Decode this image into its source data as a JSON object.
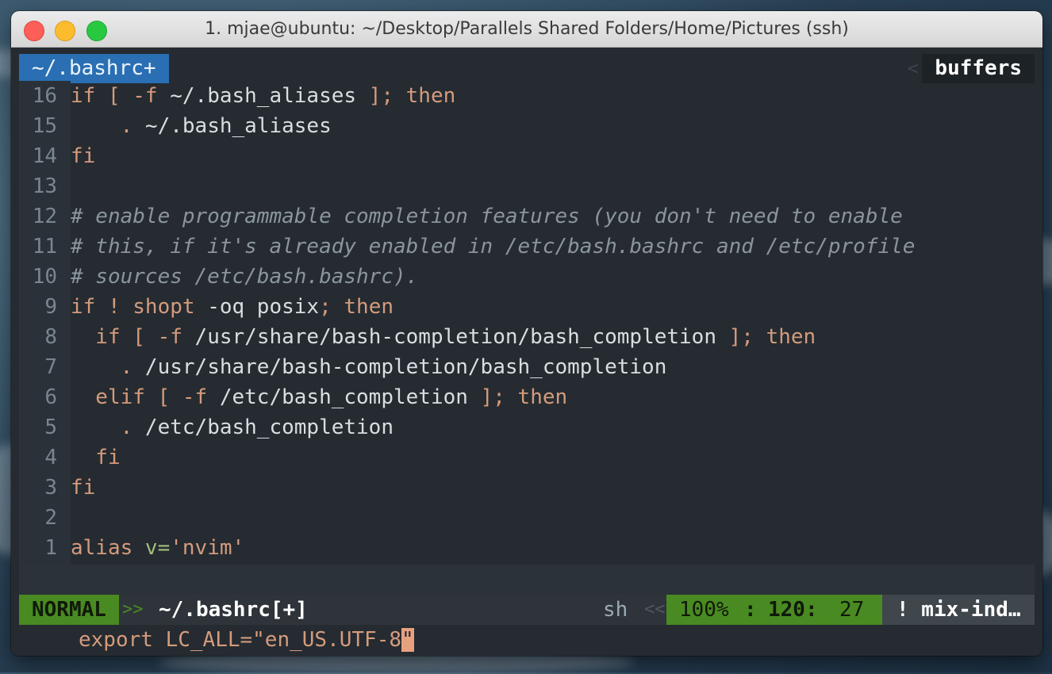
{
  "window": {
    "title": "1. mjae@ubuntu: ~/Desktop/Parallels Shared Folders/Home/Pictures (ssh)"
  },
  "tabline": {
    "active_tab": "~/.bashrc+",
    "right_label": "buffers",
    "separator": "<"
  },
  "lines": [
    {
      "num": "16",
      "tokens": [
        {
          "t": "if [ -f ",
          "c": "kw"
        },
        {
          "t": "~/.bash_aliases ",
          "c": "pl"
        },
        {
          "t": "]; then",
          "c": "kw"
        }
      ]
    },
    {
      "num": "15",
      "tokens": [
        {
          "t": "    . ",
          "c": "kw"
        },
        {
          "t": "~/.bash_aliases",
          "c": "pl"
        }
      ]
    },
    {
      "num": "14",
      "tokens": [
        {
          "t": "fi",
          "c": "kw"
        }
      ]
    },
    {
      "num": "13",
      "tokens": []
    },
    {
      "num": "12",
      "tokens": [
        {
          "t": "# enable programmable completion features (you don't need to enable",
          "c": "cm"
        }
      ]
    },
    {
      "num": "11",
      "tokens": [
        {
          "t": "# this, if it's already enabled in /etc/bash.bashrc and /etc/profile",
          "c": "cm"
        }
      ]
    },
    {
      "num": "10",
      "tokens": [
        {
          "t": "# sources /etc/bash.bashrc).",
          "c": "cm"
        }
      ]
    },
    {
      "num": "9",
      "tokens": [
        {
          "t": "if ! shopt ",
          "c": "kw"
        },
        {
          "t": "-oq posix",
          "c": "pl"
        },
        {
          "t": "; then",
          "c": "kw"
        }
      ]
    },
    {
      "num": "8",
      "tokens": [
        {
          "t": "  if [ -f ",
          "c": "kw"
        },
        {
          "t": "/usr/share/bash-completion/bash_completion ",
          "c": "pl"
        },
        {
          "t": "]; then",
          "c": "kw"
        }
      ]
    },
    {
      "num": "7",
      "tokens": [
        {
          "t": "    . ",
          "c": "kw"
        },
        {
          "t": "/usr/share/bash-completion/bash_completion",
          "c": "pl"
        }
      ]
    },
    {
      "num": "6",
      "tokens": [
        {
          "t": "  elif [ -f ",
          "c": "kw"
        },
        {
          "t": "/etc/bash_completion ",
          "c": "pl"
        },
        {
          "t": "]; then",
          "c": "kw"
        }
      ]
    },
    {
      "num": "5",
      "tokens": [
        {
          "t": "    . ",
          "c": "kw"
        },
        {
          "t": "/etc/bash_completion",
          "c": "pl"
        }
      ]
    },
    {
      "num": "4",
      "tokens": [
        {
          "t": "  fi",
          "c": "kw"
        }
      ]
    },
    {
      "num": "3",
      "tokens": [
        {
          "t": "fi",
          "c": "kw"
        }
      ]
    },
    {
      "num": "2",
      "tokens": []
    },
    {
      "num": "1",
      "tokens": [
        {
          "t": "alias ",
          "c": "kw"
        },
        {
          "t": "v=",
          "c": "gr"
        },
        {
          "t": "'nvim'",
          "c": "st"
        }
      ]
    }
  ],
  "current_line": {
    "num": "120",
    "text_before_cursor_kw": "export ",
    "text_before_cursor_var": "LC_ALL=",
    "text_before_cursor_str": "\"en_US.UTF-8",
    "cursor_char": "\""
  },
  "statusline": {
    "mode": "NORMAL",
    "mode_sep": ">>",
    "filename": "~/.bashrc[+]",
    "filetype": "sh",
    "left_sep": "<<",
    "percent": "100%",
    "sep": ":",
    "line": "120",
    "col_sep": ":",
    "column": "27",
    "right_sep": "<",
    "warning": "! mix-ind…"
  },
  "colors": {
    "mode_bg": "#4a8a22",
    "tab_active_bg": "#2a6fb3",
    "cursor": "#e8a17f",
    "keyword": "#d59b7c",
    "line_number_current": "#f2e94e"
  }
}
